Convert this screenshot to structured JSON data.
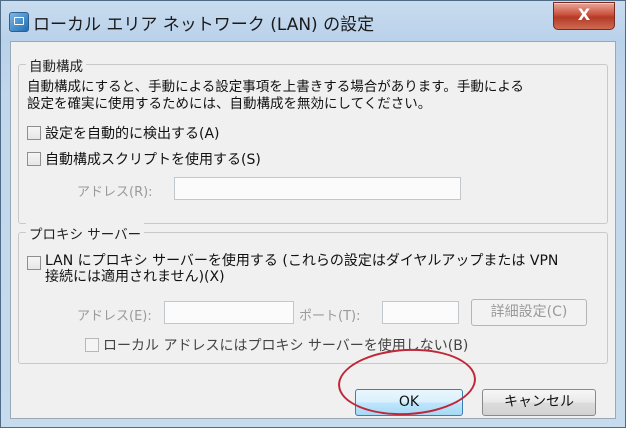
{
  "window": {
    "title": "ローカル エリア ネットワーク (LAN) の設定",
    "close_glyph": "X"
  },
  "auto_config": {
    "legend": "自動構成",
    "description_line1": "自動構成にすると、手動による設定事項を上書きする場合があります。手動による",
    "description_line2": "設定を確実に使用するためには、自動構成を無効にしてください。",
    "auto_detect_label": "設定を自動的に検出する(A)",
    "auto_detect_checked": false,
    "use_script_label": "自動構成スクリプトを使用する(S)",
    "use_script_checked": false,
    "address_label": "アドレス(R):",
    "address_value": ""
  },
  "proxy": {
    "legend": "プロキシ サーバー",
    "use_proxy_line1": "LAN にプロキシ サーバーを使用する (これらの設定はダイヤルアップまたは VPN",
    "use_proxy_line2": "接続には適用されません)(X)",
    "use_proxy_checked": false,
    "address_label": "アドレス(E):",
    "address_value": "",
    "port_label": "ポート(T):",
    "port_value": "",
    "advanced_label": "詳細設定(C)",
    "bypass_local_label": "ローカル アドレスにはプロキシ サーバーを使用しない(B)",
    "bypass_local_checked": false
  },
  "buttons": {
    "ok_label": "OK",
    "cancel_label": "キャンセル"
  },
  "colors": {
    "highlight_oval": "#c0283a",
    "title_bar": "#b9d1ea",
    "close_button": "#c9513b"
  }
}
